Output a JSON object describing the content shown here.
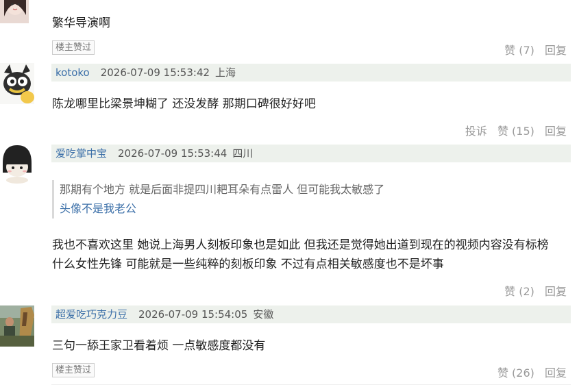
{
  "comments": [
    {
      "text": "繁华导演啊",
      "badge": "楼主赞过",
      "like": "赞 (7)",
      "reply": "回复"
    },
    {
      "user": "kotoko",
      "time": "2026-07-09 15:53:42",
      "location": "上海",
      "text": "陈龙哪里比梁景坤糊了 还没发酵 那期口碑很好好吧",
      "report": "投诉",
      "like": "赞 (15)",
      "reply": "回复"
    },
    {
      "user": "爱吃掌中宝",
      "time": "2026-07-09 15:53:44",
      "location": "四川",
      "quote_line1": "那期有个地方 就是后面非提四川耙耳朵有点雷人 但可能我太敏感了",
      "quote_line2": "头像不是我老公",
      "text_line1": "我也不喜欢这里 她说上海男人刻板印象也是如此 但我还是觉得她出道到现在的视频内容没有标榜",
      "text_line2": "什么女性先锋 可能就是一些纯粹的刻板印象 不过有点相关敏感度也不是坏事",
      "like": "赞 (2)",
      "reply": "回复"
    },
    {
      "user": "超爱吃巧克力豆",
      "time": "2026-07-09 15:54:05",
      "location": "安徽",
      "text": "三句一舔王家卫看着烦 一点敏感度都没有",
      "badge": "楼主赞过",
      "like": "赞 (26)",
      "reply": "回复"
    }
  ]
}
